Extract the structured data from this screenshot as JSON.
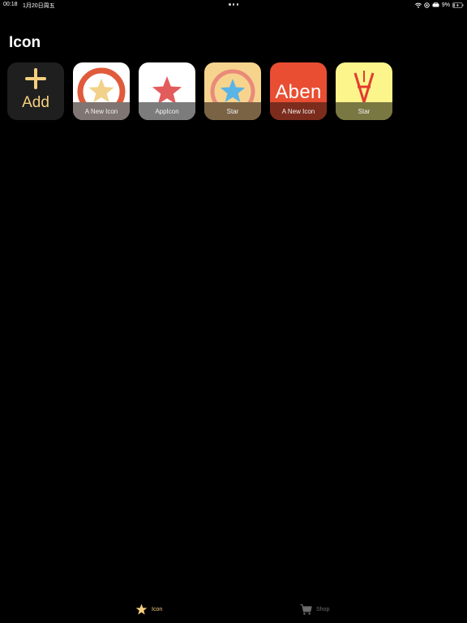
{
  "status_bar": {
    "time": "00:18",
    "date": "1月20日周五",
    "battery": "9%",
    "icons": [
      "wifi-icon",
      "location-icon",
      "vpn-icon",
      "battery-icon",
      "charging-icon"
    ]
  },
  "page": {
    "title": "Icon"
  },
  "grid": {
    "add_tile": {
      "label": "Add",
      "icon": "plus-icon"
    },
    "tiles": [
      {
        "caption": "A New Icon",
        "art": "ring-star",
        "bg": "#ffffff",
        "ring": "#e05a3c",
        "star": "#f2d28a",
        "caption_bg": "#7f7572"
      },
      {
        "caption": "AppIcon",
        "art": "star",
        "bg": "#ffffff",
        "star": "#e35c5c",
        "caption_bg": "#7c7c7c"
      },
      {
        "caption": "Star",
        "art": "ring-star",
        "bg": "#f7d48e",
        "ring": "#e98b7a",
        "star": "#5ab4e6",
        "caption_bg": "#7a6345"
      },
      {
        "caption": "A New Icon",
        "art": "text",
        "text": "Aben",
        "bg": "#e94e32",
        "caption_bg": "#7c2c1d"
      },
      {
        "caption": "Star",
        "art": "turned-a",
        "bg": "#fbf58c",
        "stroke": "#e33b2f",
        "caption_bg": "#797742"
      }
    ]
  },
  "tab_bar": {
    "accent": "#f6cf7f",
    "inactive": "#6e6e6e",
    "tabs": [
      {
        "label": "Icon",
        "icon": "star-icon",
        "active": true
      },
      {
        "label": "Shop",
        "icon": "cart-icon",
        "active": false
      }
    ]
  }
}
